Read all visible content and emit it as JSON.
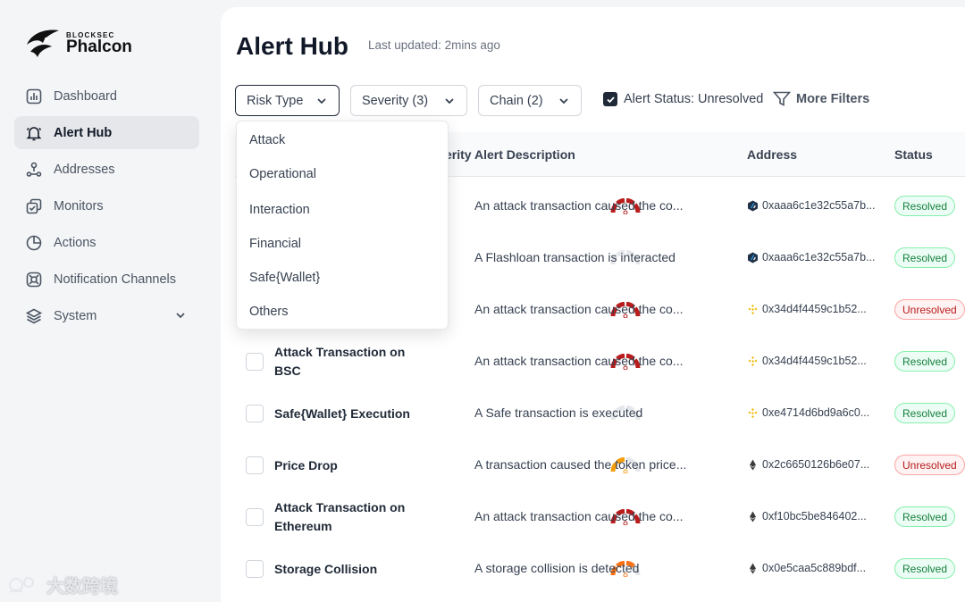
{
  "brand": {
    "small": "BLOCKSEC",
    "name": "Phalcon"
  },
  "sidebar": {
    "items": [
      {
        "label": "Dashboard",
        "icon": "chart-icon"
      },
      {
        "label": "Alert Hub",
        "icon": "bell-icon",
        "active": true
      },
      {
        "label": "Addresses",
        "icon": "address-icon"
      },
      {
        "label": "Monitors",
        "icon": "monitor-icon"
      },
      {
        "label": "Actions",
        "icon": "pie-icon"
      },
      {
        "label": "Notification Channels",
        "icon": "channel-icon"
      },
      {
        "label": "System",
        "icon": "layers-icon"
      }
    ]
  },
  "header": {
    "title": "Alert Hub",
    "updated": "Last updated: 2mins ago"
  },
  "filters": {
    "risk_type": "Risk Type",
    "severity": "Severity (3)",
    "chain": "Chain (2)",
    "alert_status": "Alert Status: Unresolved",
    "more": "More Filters"
  },
  "dropdown": {
    "options": [
      "Attack",
      "Operational",
      "Interaction",
      "Financial",
      "Safe{Wallet}",
      "Others"
    ]
  },
  "table": {
    "headers": {
      "severity_partial": "erity",
      "description": "Alert Description",
      "address": "Address",
      "status": "Status"
    },
    "rows": [
      {
        "name": "",
        "severity": "high",
        "description": "An attack transaction caused the co...",
        "chain": "arbitrum",
        "address": "0xaaa6c1e32c55a7b...",
        "status": "Resolved"
      },
      {
        "name": "",
        "severity": "none",
        "description": "A Flashloan transaction is interacted",
        "chain": "arbitrum",
        "address": "0xaaa6c1e32c55a7b...",
        "status": "Resolved"
      },
      {
        "name": "",
        "severity": "high",
        "description": "An attack transaction caused the co...",
        "chain": "bsc",
        "address": "0x34d4f4459c1b52...",
        "status": "Unresolved"
      },
      {
        "name": "Attack Transaction on BSC",
        "severity": "high",
        "description": "An attack transaction caused the co...",
        "chain": "bsc",
        "address": "0x34d4f4459c1b52...",
        "status": "Resolved"
      },
      {
        "name": "Safe{Wallet} Execution",
        "severity": "none",
        "description": "A Safe transaction is executed",
        "chain": "bsc",
        "address": "0xe4714d6bd9a6c0...",
        "status": "Resolved"
      },
      {
        "name": "Price Drop",
        "severity": "low",
        "description": "A transaction caused the token price...",
        "chain": "ethereum",
        "address": "0x2c6650126b6e07...",
        "status": "Unresolved"
      },
      {
        "name": "Attack Transaction on Ethereum",
        "severity": "high",
        "description": "An attack transaction caused the co...",
        "chain": "ethereum",
        "address": "0xf10bc5be846402...",
        "status": "Resolved"
      },
      {
        "name": "Storage Collision",
        "severity": "medium",
        "description": "A storage collision is detected",
        "chain": "ethereum",
        "address": "0x0e5caa5c889bdf...",
        "status": "Resolved"
      }
    ]
  },
  "watermark": "大数跨境",
  "colors": {
    "high": "#b91c1c",
    "medium": "#f97316",
    "low": "#f59e0b",
    "none": "#e5e7eb"
  }
}
